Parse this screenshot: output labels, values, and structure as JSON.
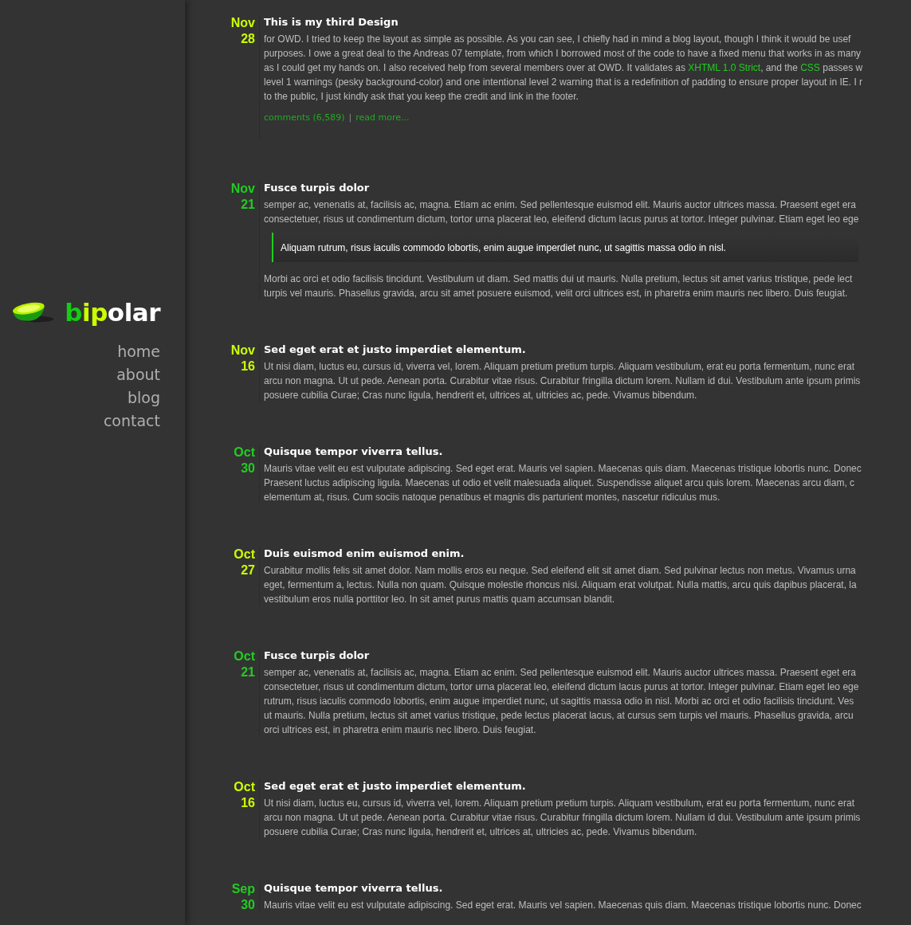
{
  "logo": [
    {
      "text": "b",
      "color": "#14cc14"
    },
    {
      "text": "ip",
      "color": "#ccff00"
    },
    {
      "text": "olar",
      "color": "#ffffff"
    }
  ],
  "nav": [
    {
      "label": "home"
    },
    {
      "label": "about"
    },
    {
      "label": "blog"
    },
    {
      "label": "contact"
    }
  ],
  "posts": [
    {
      "month": "Nov",
      "day": "28",
      "color": "#ccff00",
      "title": "This is my third Design",
      "blocks": [
        {
          "kind": "paragraph",
          "lines": [
            [
              {
                "text": "for OWD. I tried to keep the layout as simple as possible. As you can see, I chiefly had in mind a blog layout, though I think it would be usef",
                "kind": "text"
              }
            ],
            [
              {
                "text": "purposes. I owe a great deal to the Andreas 07 template, from which I borrowed most of the code to have a fixed menu that works in as many",
                "kind": "text"
              }
            ],
            [
              {
                "text": "as I could get my hands on. I also received help from several members over at OWD. It validates as ",
                "kind": "text"
              },
              {
                "text": "XHTML 1.0 Strict",
                "kind": "link"
              },
              {
                "text": ", and the ",
                "kind": "text"
              },
              {
                "text": "CSS",
                "kind": "link"
              },
              {
                "text": " passes w",
                "kind": "text"
              }
            ],
            [
              {
                "text": "level 1 warnings (pesky background-color) and one intentional level 2 warning that is a redefinition of padding to ensure proper layout in IE. I r",
                "kind": "text"
              }
            ],
            [
              {
                "text": "to the public, I just kindly ask that you keep the credit and link in the footer.",
                "kind": "text"
              }
            ]
          ]
        }
      ],
      "meta": {
        "comments": "comments (6,589)",
        "separator": "|",
        "more": "read more..."
      }
    },
    {
      "month": "Nov",
      "day": "21",
      "color": "#22cc22",
      "title": "Fusce turpis dolor",
      "blocks": [
        {
          "kind": "paragraph",
          "lines": [
            [
              {
                "text": "semper ac, venenatis at, facilisis ac, magna. Etiam ac enim. Sed pellentesque euismod elit. Mauris auctor ultrices massa. Praesent eget era",
                "kind": "text"
              }
            ],
            [
              {
                "text": "consectetuer, risus ut condimentum dictum, tortor urna placerat leo, eleifend dictum lacus purus at tortor. Integer pulvinar. Etiam eget leo ege",
                "kind": "text"
              }
            ]
          ]
        },
        {
          "kind": "quote",
          "lines": [
            [
              {
                "text": "Aliquam rutrum, risus iaculis commodo lobortis, enim augue imperdiet nunc, ut sagittis massa odio in nisl.",
                "kind": "text"
              }
            ]
          ]
        },
        {
          "kind": "paragraph",
          "lines": [
            [
              {
                "text": "Morbi ac orci et odio facilisis tincidunt. Vestibulum ut diam. Sed mattis dui ut mauris. Nulla pretium, lectus sit amet varius tristique, pede lect",
                "kind": "text"
              }
            ],
            [
              {
                "text": "turpis vel mauris. Phasellus gravida, arcu sit amet posuere euismod, velit orci ultrices est, in pharetra enim mauris nec libero. Duis feugiat.",
                "kind": "text"
              }
            ]
          ]
        }
      ]
    },
    {
      "month": "Nov",
      "day": "16",
      "color": "#ccff00",
      "title": "Sed eget erat et justo imperdiet elementum.",
      "blocks": [
        {
          "kind": "paragraph",
          "lines": [
            [
              {
                "text": "Ut nisi diam, luctus eu, cursus id, viverra vel, lorem. Aliquam pretium pretium turpis. Aliquam vestibulum, erat eu porta fermentum, nunc erat",
                "kind": "text"
              }
            ],
            [
              {
                "text": "arcu non magna. Ut ut pede. Aenean porta. Curabitur vitae risus. Curabitur fringilla dictum lorem. Nullam id dui. Vestibulum ante ipsum primis",
                "kind": "text"
              }
            ],
            [
              {
                "text": "posuere cubilia Curae; Cras nunc ligula, hendrerit et, ultrices at, ultricies ac, pede. Vivamus bibendum.",
                "kind": "text"
              }
            ]
          ]
        }
      ]
    },
    {
      "month": "Oct",
      "day": "30",
      "color": "#22cc22",
      "title": "Quisque tempor viverra tellus.",
      "blocks": [
        {
          "kind": "paragraph",
          "lines": [
            [
              {
                "text": "Mauris vitae velit eu est vulputate adipiscing. Sed eget erat. Mauris vel sapien. Maecenas quis diam. Maecenas tristique lobortis nunc. Donec",
                "kind": "text"
              }
            ],
            [
              {
                "text": "Praesent luctus adipiscing ligula. Maecenas ut odio et velit malesuada aliquet. Suspendisse aliquet arcu quis lorem. Maecenas arcu diam, c",
                "kind": "text"
              }
            ],
            [
              {
                "text": "elementum at, risus. Cum sociis natoque penatibus et magnis dis parturient montes, nascetur ridiculus mus.",
                "kind": "text"
              }
            ]
          ]
        }
      ]
    },
    {
      "month": "Oct",
      "day": "27",
      "color": "#ccff00",
      "title": "Duis euismod enim euismod enim.",
      "blocks": [
        {
          "kind": "paragraph",
          "lines": [
            [
              {
                "text": "Curabitur mollis felis sit amet dolor. Nam mollis eros eu neque. Sed eleifend elit sit amet diam. Sed pulvinar lectus non metus. Vivamus urna",
                "kind": "text"
              }
            ],
            [
              {
                "text": "eget, fermentum a, lectus. Nulla non quam. Quisque molestie rhoncus nisi. Aliquam erat volutpat. Nulla mattis, arcu quis dapibus placerat, la",
                "kind": "text"
              }
            ],
            [
              {
                "text": "vestibulum eros nulla porttitor leo. In sit amet purus mattis quam accumsan blandit.",
                "kind": "text"
              }
            ]
          ]
        }
      ]
    },
    {
      "month": "Oct",
      "day": "21",
      "color": "#22cc22",
      "title": "Fusce turpis dolor",
      "blocks": [
        {
          "kind": "paragraph",
          "lines": [
            [
              {
                "text": "semper ac, venenatis at, facilisis ac, magna. Etiam ac enim. Sed pellentesque euismod elit. Mauris auctor ultrices massa. Praesent eget era",
                "kind": "text"
              }
            ],
            [
              {
                "text": "consectetuer, risus ut condimentum dictum, tortor urna placerat leo, eleifend dictum lacus purus at tortor. Integer pulvinar. Etiam eget leo ege",
                "kind": "text"
              }
            ],
            [
              {
                "text": "rutrum, risus iaculis commodo lobortis, enim augue imperdiet nunc, ut sagittis massa odio in nisl. Morbi ac orci et odio facilisis tincidunt. Ves",
                "kind": "text"
              }
            ],
            [
              {
                "text": "ut mauris. Nulla pretium, lectus sit amet varius tristique, pede lectus placerat lacus, at cursus sem turpis vel mauris. Phasellus gravida, arcu",
                "kind": "text"
              }
            ],
            [
              {
                "text": "orci ultrices est, in pharetra enim mauris nec libero. Duis feugiat.",
                "kind": "text"
              }
            ]
          ]
        }
      ]
    },
    {
      "month": "Oct",
      "day": "16",
      "color": "#ccff00",
      "title": "Sed eget erat et justo imperdiet elementum.",
      "blocks": [
        {
          "kind": "paragraph",
          "lines": [
            [
              {
                "text": "Ut nisi diam, luctus eu, cursus id, viverra vel, lorem. Aliquam pretium pretium turpis. Aliquam vestibulum, erat eu porta fermentum, nunc erat",
                "kind": "text"
              }
            ],
            [
              {
                "text": "arcu non magna. Ut ut pede. Aenean porta. Curabitur vitae risus. Curabitur fringilla dictum lorem. Nullam id dui. Vestibulum ante ipsum primis",
                "kind": "text"
              }
            ],
            [
              {
                "text": "posuere cubilia Curae; Cras nunc ligula, hendrerit et, ultrices at, ultricies ac, pede. Vivamus bibendum.",
                "kind": "text"
              }
            ]
          ]
        }
      ]
    },
    {
      "month": "Sep",
      "day": "30",
      "color": "#22cc22",
      "title": "Quisque tempor viverra tellus.",
      "blocks": [
        {
          "kind": "paragraph",
          "lines": [
            [
              {
                "text": "Mauris vitae velit eu est vulputate adipiscing. Sed eget erat. Mauris vel sapien. Maecenas quis diam. Maecenas tristique lobortis nunc. Donec",
                "kind": "text"
              }
            ]
          ]
        }
      ]
    }
  ]
}
